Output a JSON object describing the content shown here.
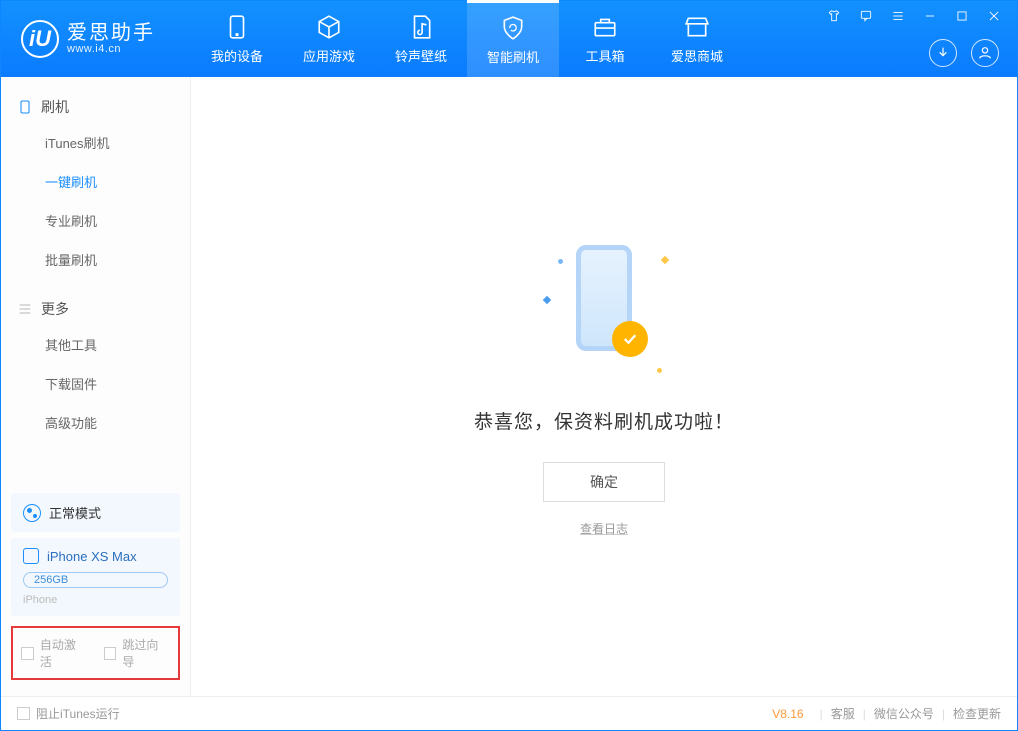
{
  "app": {
    "name": "爱思助手",
    "url": "www.i4.cn",
    "logo_letter": "iU"
  },
  "tabs": {
    "device": "我的设备",
    "apps": "应用游戏",
    "ringtones": "铃声壁纸",
    "flash": "智能刷机",
    "toolbox": "工具箱",
    "store": "爱思商城"
  },
  "sidebar": {
    "group1_title": "刷机",
    "group1_items": {
      "itunes": "iTunes刷机",
      "onekey": "一键刷机",
      "pro": "专业刷机",
      "batch": "批量刷机"
    },
    "group2_title": "更多",
    "group2_items": {
      "other": "其他工具",
      "download": "下载固件",
      "advanced": "高级功能"
    },
    "mode": "正常模式",
    "device": {
      "name": "iPhone XS Max",
      "storage": "256GB",
      "type": "iPhone"
    },
    "checkboxes": {
      "auto_activate": "自动激活",
      "skip_guide": "跳过向导"
    }
  },
  "main": {
    "success_title": "恭喜您，保资料刷机成功啦！",
    "ok_button": "确定",
    "view_log": "查看日志"
  },
  "footer": {
    "block_itunes": "阻止iTunes运行",
    "version": "V8.16",
    "support": "客服",
    "wechat": "微信公众号",
    "update": "检查更新"
  }
}
